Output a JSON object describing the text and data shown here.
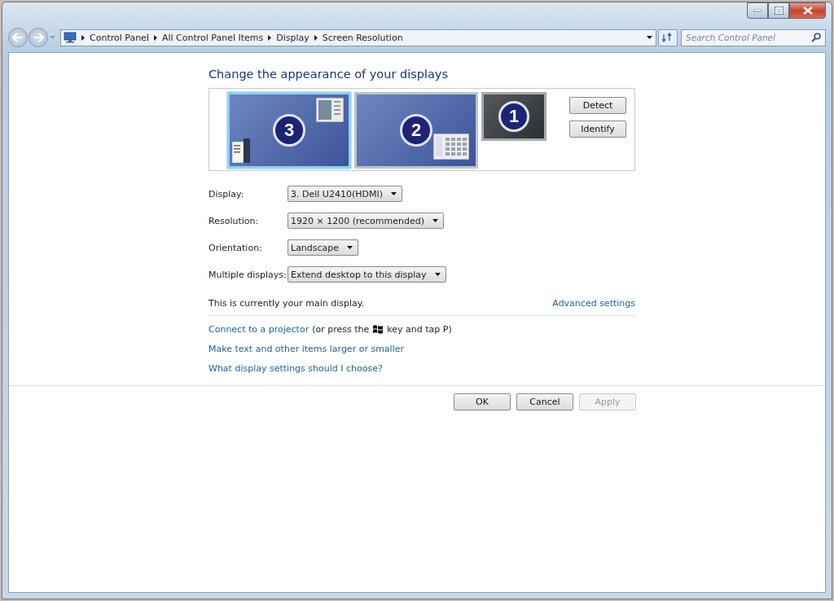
{
  "window": {
    "controls": [
      {
        "kind": "minimize"
      },
      {
        "kind": "maximize"
      },
      {
        "kind": "close"
      }
    ]
  },
  "address_bar": {
    "crumbs": [
      "Control Panel",
      "All Control Panel Items",
      "Display",
      "Screen Resolution"
    ]
  },
  "search": {
    "placeholder": "Search Control Panel"
  },
  "heading": "Change the appearance of your displays",
  "monitors": [
    {
      "number": "3",
      "selected": true,
      "kind": "primary",
      "dimmed": false
    },
    {
      "number": "2",
      "selected": false,
      "kind": "secondary",
      "dimmed": false
    },
    {
      "number": "1",
      "selected": false,
      "kind": "compact",
      "dimmed": true
    }
  ],
  "side_buttons": [
    "Detect",
    "Identify"
  ],
  "settings": [
    {
      "label": "Display:",
      "value": "3. Dell U2410(HDMI)"
    },
    {
      "label": "Resolution:",
      "value": "1920 × 1200 (recommended)"
    },
    {
      "label": "Orientation:",
      "value": "Landscape"
    },
    {
      "label": "Multiple displays:",
      "value": "Extend desktop to this display"
    }
  ],
  "main_display_note": "This is currently your main display.",
  "advanced_link": "Advanced settings",
  "projector": {
    "link": "Connect to a projector",
    "before_key": "(or press the",
    "after_key": "key and tap P)"
  },
  "links": [
    "Make text and other items larger or smaller",
    "What display settings should I choose?"
  ],
  "buttons": [
    {
      "label": "OK",
      "disabled": false
    },
    {
      "label": "Cancel",
      "disabled": false
    },
    {
      "label": "Apply",
      "disabled": true
    }
  ]
}
